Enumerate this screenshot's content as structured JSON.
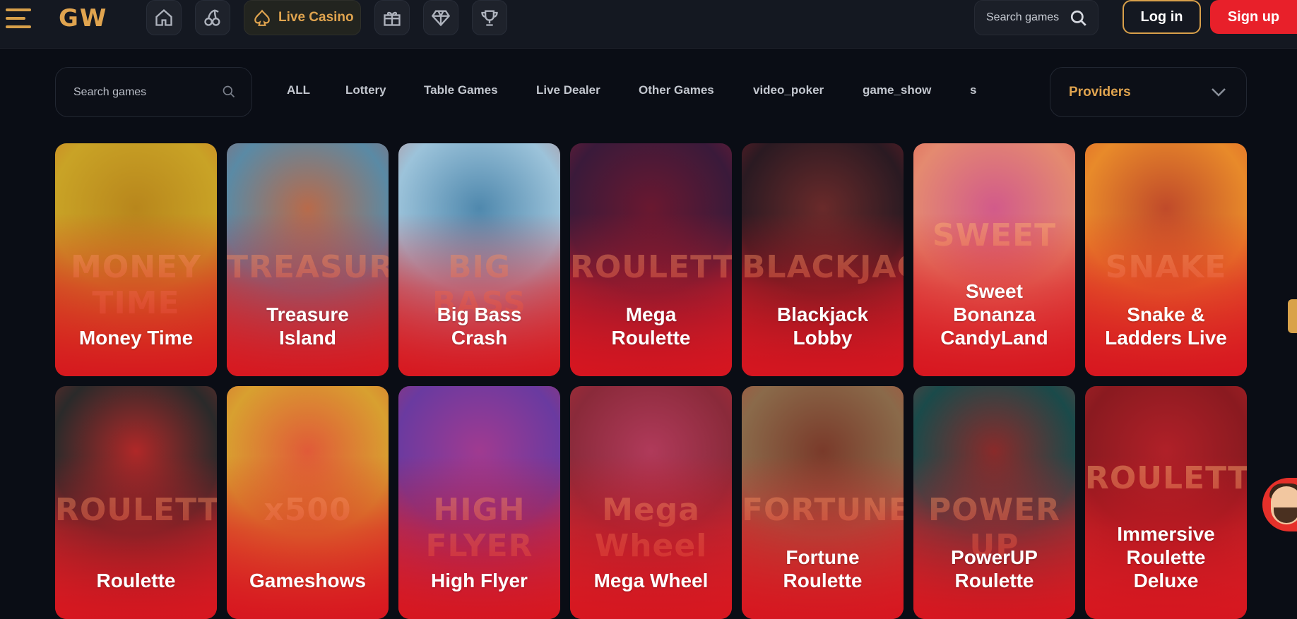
{
  "header": {
    "logo": "GW",
    "live_casino": "Live Casino",
    "search_placeholder": "Search games",
    "login": "Log in",
    "signup": "Sign up"
  },
  "filters": {
    "search_placeholder": "Search games",
    "categories": [
      "ALL",
      "Lottery",
      "Table Games",
      "Live Dealer",
      "Other Games",
      "video_poker",
      "game_show",
      "s"
    ],
    "providers": "Providers"
  },
  "games": [
    {
      "title_lines": [
        "Money Time"
      ],
      "art": "MONEY TIME",
      "colors": [
        "#c9a326",
        "#b8861c",
        "#d04a22"
      ]
    },
    {
      "title_lines": [
        "Treasure",
        "Island"
      ],
      "art": "TREASURE",
      "colors": [
        "#5a8aa5",
        "#b86a4a",
        "#d8402e"
      ]
    },
    {
      "title_lines": [
        "Big Bass",
        "Crash"
      ],
      "art": "BIG BASS",
      "colors": [
        "#9cc3da",
        "#4f88ad",
        "#d8402e"
      ]
    },
    {
      "title_lines": [
        "Mega",
        "Roulette"
      ],
      "art": "ROULETTE",
      "colors": [
        "#3a1a3a",
        "#6a1830",
        "#c9202e"
      ]
    },
    {
      "title_lines": [
        "Blackjack",
        "Lobby"
      ],
      "art": "BLACKJACK",
      "colors": [
        "#2a1a22",
        "#6a2a2a",
        "#c9222e"
      ]
    },
    {
      "title_lines": [
        "Sweet",
        "Bonanza",
        "CandyLand"
      ],
      "art": "SWEET",
      "colors": [
        "#e48a70",
        "#d25a8a",
        "#d8302e"
      ]
    },
    {
      "title_lines": [
        "Snake &",
        "Ladders Live"
      ],
      "art": "SNAKE",
      "colors": [
        "#e88a2a",
        "#c04a2a",
        "#d8302e"
      ]
    },
    {
      "title_lines": [
        "Roulette"
      ],
      "art": "ROULETTE",
      "colors": [
        "#2a2a2a",
        "#b02828",
        "#d8302e"
      ]
    },
    {
      "title_lines": [
        "Gameshows"
      ],
      "art": "x500",
      "colors": [
        "#d8a030",
        "#e05a38",
        "#d8302e"
      ]
    },
    {
      "title_lines": [
        "High Flyer"
      ],
      "art": "HIGH FLYER",
      "colors": [
        "#6a3aa0",
        "#a03a90",
        "#d8302e"
      ]
    },
    {
      "title_lines": [
        "Mega Wheel"
      ],
      "art": "Mega Wheel",
      "colors": [
        "#8a2a3a",
        "#b03a5a",
        "#d8302e"
      ]
    },
    {
      "title_lines": [
        "Fortune",
        "Roulette"
      ],
      "art": "FORTUNE",
      "colors": [
        "#8a6a4a",
        "#7a3a2a",
        "#d8302e"
      ]
    },
    {
      "title_lines": [
        "PowerUP",
        "Roulette"
      ],
      "art": "POWER UP",
      "colors": [
        "#1a4a4a",
        "#8a2a2a",
        "#d8302e"
      ]
    },
    {
      "title_lines": [
        "Immersive",
        "Roulette",
        "Deluxe"
      ],
      "art": "ROULETTE",
      "colors": [
        "#8a1a20",
        "#b02028",
        "#d8302e"
      ]
    }
  ]
}
